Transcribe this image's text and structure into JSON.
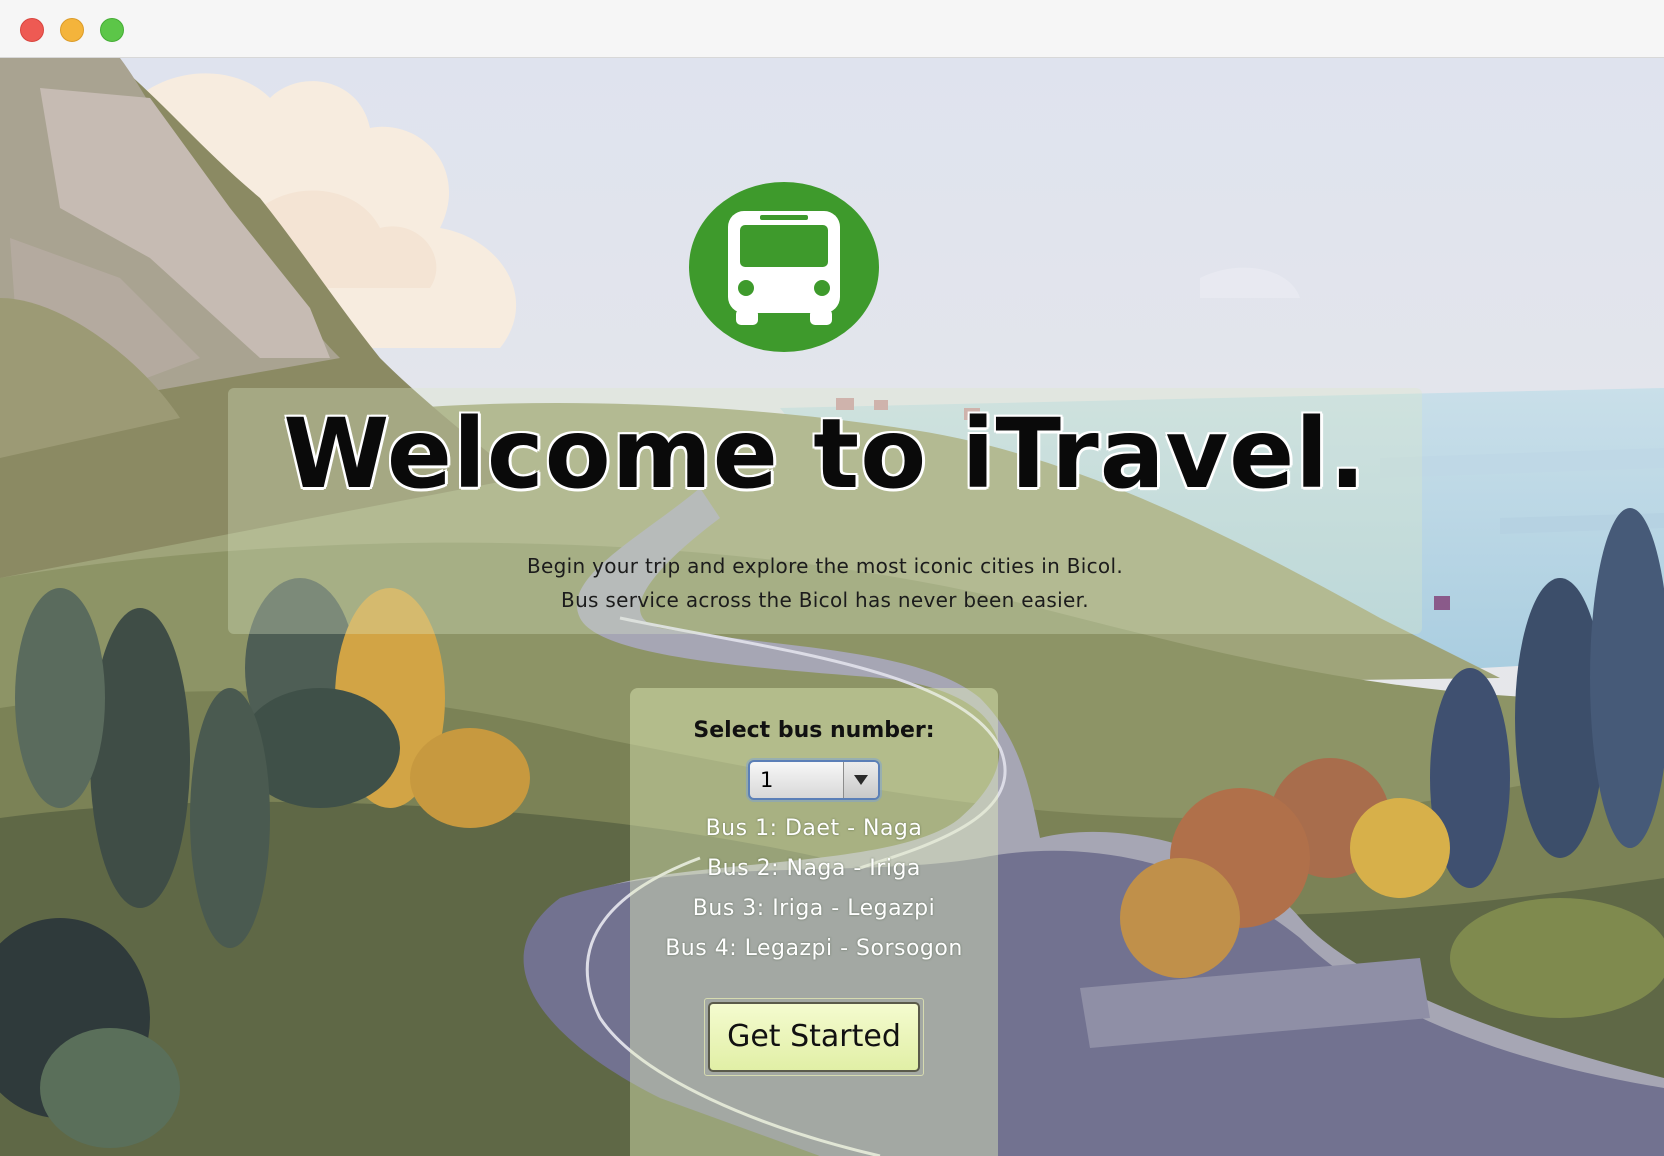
{
  "window": {
    "controls": [
      "close",
      "minimize",
      "maximize"
    ]
  },
  "hero": {
    "logo_icon": "bus-icon",
    "headline": "Welcome to iTravel.",
    "subtitle_line1": "Begin your trip and explore the most iconic cities in Bicol.",
    "subtitle_line2": "Bus service across the Bicol has never been easier."
  },
  "selector": {
    "label": "Select bus number:",
    "selected_value": "1",
    "routes": [
      "Bus 1: Daet - Naga",
      "Bus 2: Naga - Iriga",
      "Bus 3: Iriga - Legazpi",
      "Bus 4: Legazpi - Sorsogon"
    ],
    "button_label": "Get Started"
  },
  "colors": {
    "logo_green": "#3e9a2c",
    "button_fill": "#eaf5b8"
  }
}
